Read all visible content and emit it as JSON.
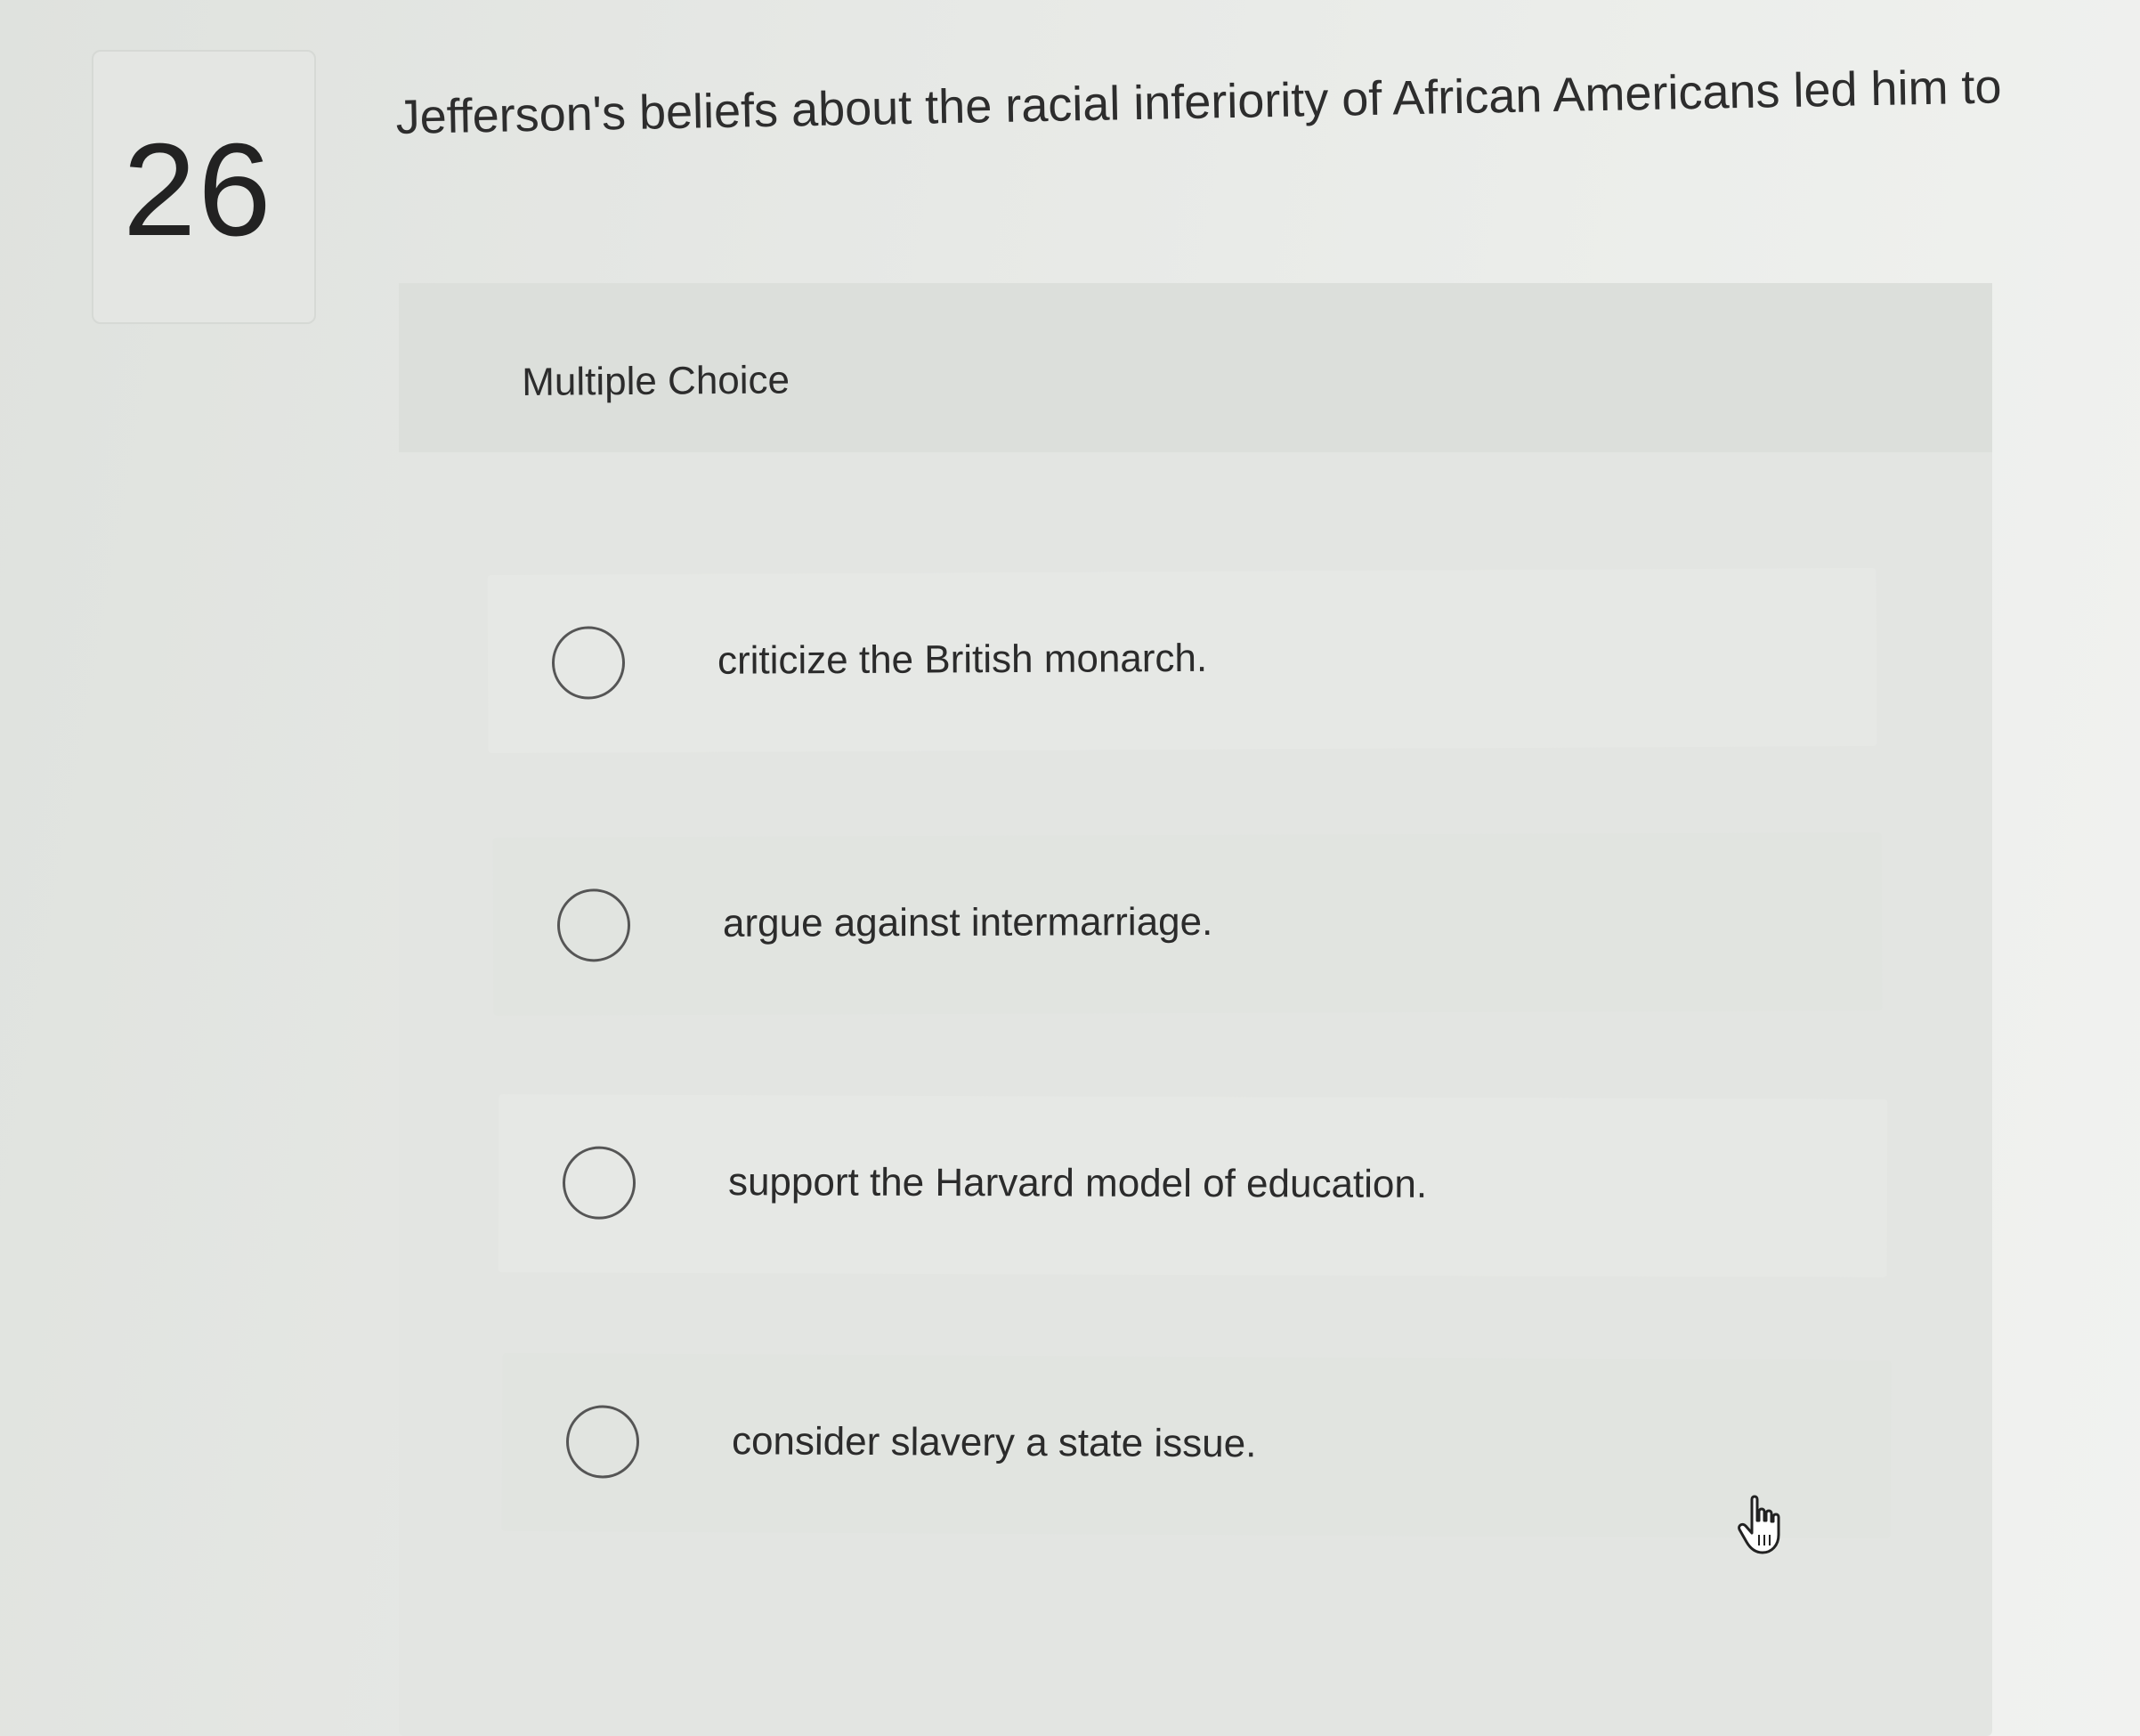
{
  "question": {
    "number": "26",
    "prompt": "Jefferson's beliefs about the racial inferiority of African Americans led him to"
  },
  "quiz": {
    "type_label": "Multiple Choice",
    "choices": [
      {
        "label": "criticize the British monarch.",
        "selected": false
      },
      {
        "label": "argue against intermarriage.",
        "selected": false
      },
      {
        "label": "support the Harvard model of education.",
        "selected": false
      },
      {
        "label": "consider slavery a state issue.",
        "selected": false
      }
    ]
  },
  "pointer": {
    "icon": "hand-pointer-icon"
  }
}
